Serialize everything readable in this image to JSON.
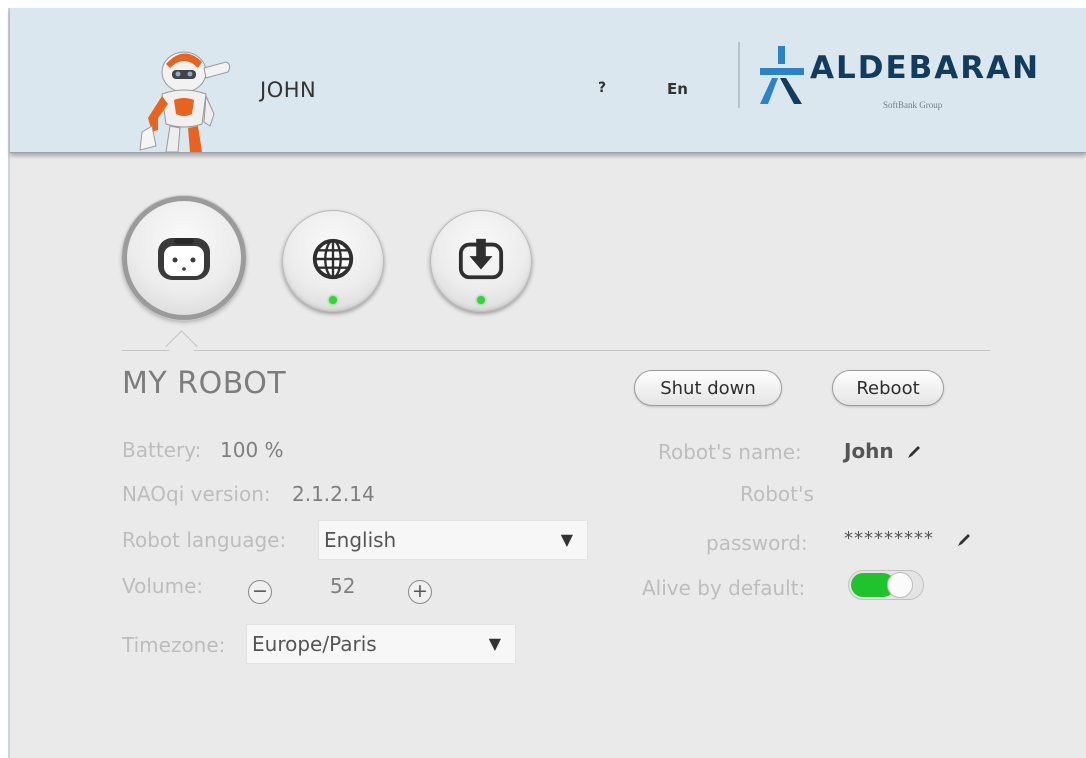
{
  "header": {
    "user_name": "JOHN",
    "help_label": "?",
    "language_label": "En",
    "logo_text": "ALDEBARAN",
    "logo_sub": "SoftBank Group"
  },
  "tabs": [
    {
      "name": "my-robot",
      "active": true
    },
    {
      "name": "network",
      "active": false,
      "status_color": "#36d23a"
    },
    {
      "name": "updates",
      "active": false,
      "status_color": "#36d23a"
    }
  ],
  "robot": {
    "title": "MY ROBOT",
    "shutdown_label": "Shut down",
    "reboot_label": "Reboot",
    "battery_label": "Battery:",
    "battery_value": "100 %",
    "naoqi_label": "NAOqi version:",
    "naoqi_value": "2.1.2.14",
    "language_label": "Robot language:",
    "language_value": "English",
    "volume_label": "Volume:",
    "volume_value": "52",
    "timezone_label": "Timezone:",
    "timezone_value": "Europe/Paris",
    "name_label": "Robot's name:",
    "name_value": "John",
    "password_label_1": "Robot's",
    "password_label_2": "password:",
    "password_value": "*********",
    "alive_label": "Alive by default:",
    "alive_enabled": true
  },
  "colors": {
    "header_bg": "#dbe7ef",
    "toggle_on": "#1fc42c",
    "status_dot": "#36d23a",
    "brand": "#123c5c",
    "brand_accent": "#2a82c8"
  }
}
